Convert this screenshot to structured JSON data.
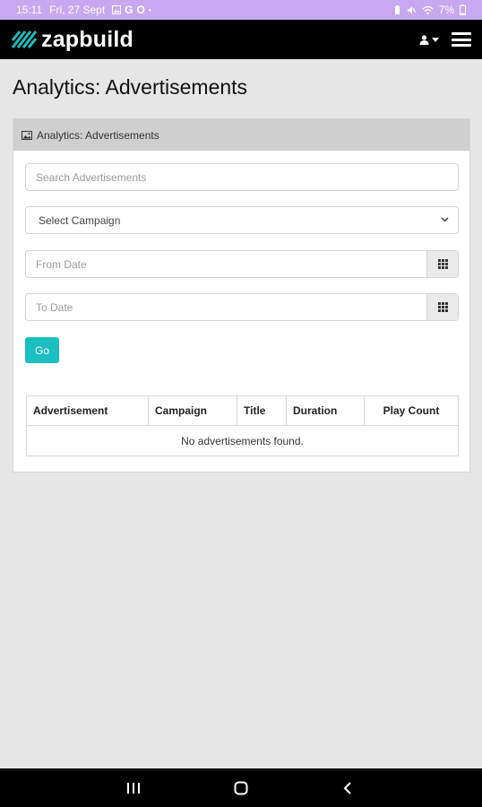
{
  "status_bar": {
    "time": "15:11",
    "date": "Fri, 27 Sept",
    "notification_letters": [
      "G",
      "O"
    ],
    "battery": "7%"
  },
  "header": {
    "logo_text": "zapbuild",
    "user_menu_icon": "user-icon",
    "menu_icon": "hamburger-menu-icon"
  },
  "page": {
    "title": "Analytics: Advertisements"
  },
  "card": {
    "header_label": "Analytics: Advertisements",
    "header_icon": "image-icon"
  },
  "filters": {
    "search_placeholder": "Search Advertisements",
    "campaign_select_value": "Select Campaign",
    "from_date_placeholder": "From Date",
    "to_date_placeholder": "To Date",
    "go_label": "Go"
  },
  "table": {
    "columns": [
      "Advertisement",
      "Campaign",
      "Title",
      "Duration",
      "Play Count"
    ],
    "empty_message": "No advertisements found."
  },
  "colors": {
    "status_bar": "#c8a8f0",
    "logo_accent": "#1bbfbf",
    "go_button": "#1bbfbf",
    "card_header": "#cfcfcf",
    "page_background": "#e6e6e6"
  }
}
